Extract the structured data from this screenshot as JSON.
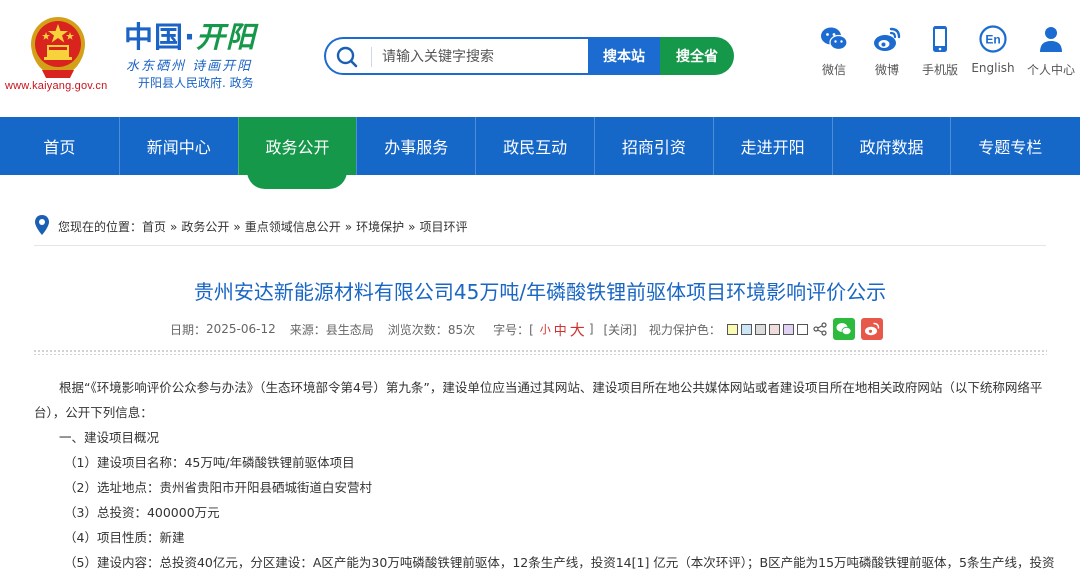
{
  "header": {
    "site_url": "www.kaiyang.gov.cn",
    "logo_main_prefix": "中国·",
    "logo_main_accent": "开阳",
    "logo_slogan": "水东硒州 诗画开阳",
    "logo_sub": "开阳县人民政府. 政务",
    "colors": {
      "primary": "#1b6bd0",
      "green": "#16984a",
      "red": "#c8141c"
    }
  },
  "search": {
    "placeholder": "请输入关键字搜索",
    "btn_site": "搜本站",
    "btn_province": "搜全省"
  },
  "quick_links": [
    {
      "label": "微信",
      "icon": "wechat-icon"
    },
    {
      "label": "微博",
      "icon": "weibo-icon"
    },
    {
      "label": "手机版",
      "icon": "mobile-icon"
    },
    {
      "label": "English",
      "icon": "english-icon"
    },
    {
      "label": "个人中心",
      "icon": "user-icon"
    }
  ],
  "nav": {
    "items": [
      "首页",
      "新闻中心",
      "政务公开",
      "办事服务",
      "政民互动",
      "招商引资",
      "走进开阳",
      "政府数据",
      "专题专栏"
    ],
    "active": "政务公开"
  },
  "breadcrumb": {
    "prefix": "您现在的位置：",
    "items": [
      "首页",
      "政务公开",
      "重点领域信息公开",
      "环境保护",
      "项目环评"
    ],
    "separator": "»"
  },
  "article": {
    "title": "贵州安达新能源材料有限公司45万吨/年磷酸铁锂前驱体项目环境影响评价公示",
    "meta": {
      "date_label": "日期：",
      "date": "2025-06-12",
      "source_label": "来源：",
      "source": "县生态局",
      "views_label": "浏览次数：",
      "views": "85次",
      "fontsize_label": "字号：[",
      "fs_small": "小",
      "fs_medium": "中",
      "fs_large": "大",
      "fontsize_end": "]",
      "close": "[关闭]",
      "eye_label": "视力保护色："
    },
    "eye_colors": [
      "#fafab4",
      "#cde6f5",
      "#dcdcdc",
      "#f0dcdc",
      "#e1d2f5",
      "#ffffff"
    ],
    "paragraphs": {
      "intro": "根据“《环境影响评价公众参与办法》（生态环境部令第4号）第九条”，建设单位应当通过其网站、建设项目所在地公共媒体网站或者建设项目所在地相关政府网站（以下统称网络平台），公开下列信息：",
      "section1": "一、建设项目概况",
      "item1": "（1）建设项目名称：45万吨/年磷酸铁锂前驱体项目",
      "item2": "（2）选址地点：贵州省贵阳市开阳县硒城街道白安营村",
      "item3": "（3）总投资：400000万元",
      "item4": "（4）项目性质：新建",
      "item5": "（5）建设内容：总投资40亿元，分区建设：A区产能为30万吨磷酸铁锂前驱体，12条生产线，投资14[1] 亿元（本次环评）；B区产能为15万吨磷酸铁锂前驱体，5条生产线，投资"
    }
  }
}
